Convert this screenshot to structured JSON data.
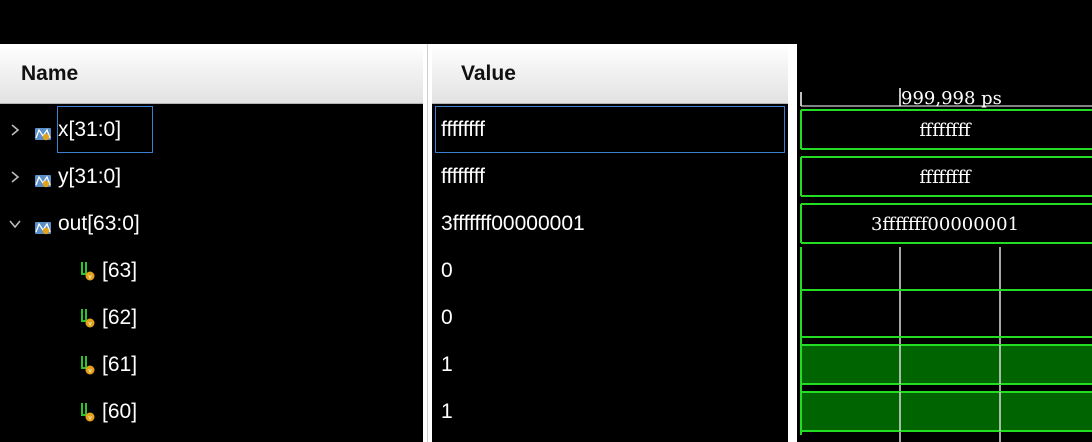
{
  "columns": {
    "name": "Name",
    "value": "Value"
  },
  "signals": [
    {
      "name": "x[31:0]",
      "value": "ffffffff",
      "kind": "bus",
      "expanded": false,
      "selected": true,
      "wave": "ffffffff"
    },
    {
      "name": "y[31:0]",
      "value": "ffffffff",
      "kind": "bus",
      "expanded": false,
      "selected": false,
      "wave": "ffffffff"
    },
    {
      "name": "out[63:0]",
      "value": "3fffffff00000001",
      "kind": "bus",
      "expanded": true,
      "selected": false,
      "wave": "3fffffff00000001"
    },
    {
      "name": "[63]",
      "value": "0",
      "kind": "bit",
      "level": 0
    },
    {
      "name": "[62]",
      "value": "0",
      "kind": "bit",
      "level": 0
    },
    {
      "name": "[61]",
      "value": "1",
      "kind": "bit",
      "level": 1
    },
    {
      "name": "[60]",
      "value": "1",
      "kind": "bit",
      "level": 1
    }
  ],
  "cursor": {
    "time_label": "999,998 ps"
  },
  "colors": {
    "wave": "#22dd22",
    "wave_fill": "#006400",
    "cursor": "#ffffff",
    "selection": "#3b7fd1"
  },
  "icons": {
    "expand": "chevron-right-icon",
    "collapse": "chevron-down-icon",
    "bus": "bus-signal-icon",
    "bit": "bit-signal-icon"
  }
}
